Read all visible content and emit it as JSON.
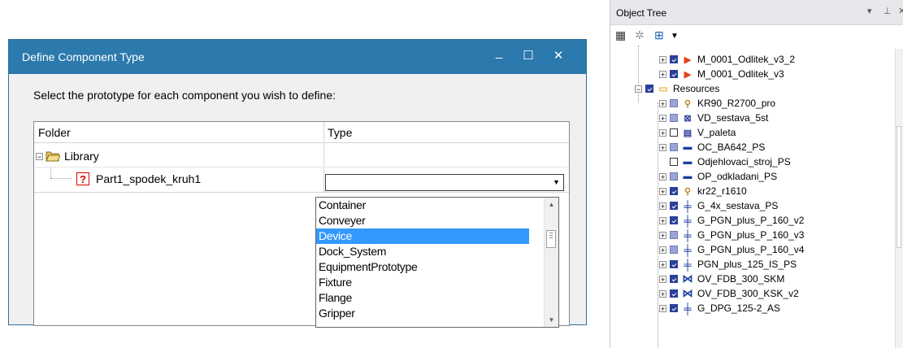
{
  "dialog": {
    "title": "Define Component Type",
    "controls": {
      "minimize": "_",
      "maximize": "☐",
      "close": "✕"
    },
    "instruction": "Select the prototype for each component you wish to define:",
    "columns": {
      "folder": "Folder",
      "type": "Type"
    },
    "library_label": "Library",
    "part_label": "Part1_spodek_kruh1",
    "combo_value": "",
    "options": [
      "Container",
      "Conveyer",
      "Device",
      "Dock_System",
      "EquipmentPrototype",
      "Fixture",
      "Flange",
      "Gripper"
    ],
    "selected_option": "Device"
  },
  "object_tree": {
    "title": "Object Tree",
    "header_buttons": {
      "dropdown": "▾",
      "pin": "⊥",
      "close": "✕"
    },
    "items": [
      {
        "label": "M_0001_Odlitek_v3_2",
        "icon": "play-icon",
        "check": "mixed"
      },
      {
        "label": "M_0001_Odlitek_v3",
        "icon": "play-icon",
        "check": "mixed"
      },
      {
        "label": "Resources",
        "icon": "folder-icon",
        "check": "mixed"
      },
      {
        "label": "KR90_R2700_pro",
        "icon": "robot-icon",
        "check": "gray"
      },
      {
        "label": "VD_sestava_5st",
        "icon": "device-icon",
        "check": "gray"
      },
      {
        "label": "V_paleta",
        "icon": "pallet-icon",
        "check": "empty"
      },
      {
        "label": "OC_BA642_PS",
        "icon": "conveyor-icon",
        "check": "gray"
      },
      {
        "label": "Odjehlovaci_stroj_PS",
        "icon": "conveyor-icon",
        "check": "empty"
      },
      {
        "label": "OP_odkladani_PS",
        "icon": "conveyor-icon",
        "check": "gray"
      },
      {
        "label": "kr22_r1610",
        "icon": "robot-icon",
        "check": "mixed"
      },
      {
        "label": "G_4x_sestava_PS",
        "icon": "gripper-icon",
        "check": "mixed"
      },
      {
        "label": "G_PGN_plus_P_160_v2",
        "icon": "gripper-icon",
        "check": "mixed"
      },
      {
        "label": "G_PGN_plus_P_160_v3",
        "icon": "gripper-icon",
        "check": "gray"
      },
      {
        "label": "G_PGN_plus_P_160_v4",
        "icon": "gripper-icon",
        "check": "gray"
      },
      {
        "label": "PGN_plus_125_IS_PS",
        "icon": "gripper-icon",
        "check": "mixed"
      },
      {
        "label": "OV_FDB_300_SKM",
        "icon": "valve-icon",
        "check": "mixed"
      },
      {
        "label": "OV_FDB_300_KSK_v2",
        "icon": "valve-icon",
        "check": "mixed"
      },
      {
        "label": "G_DPG_125-2_AS",
        "icon": "gripper-icon",
        "check": "mixed"
      }
    ]
  },
  "colors": {
    "titlebar": "#2b79ad",
    "selection": "#3399ff",
    "error_icon": "#dd0000"
  }
}
